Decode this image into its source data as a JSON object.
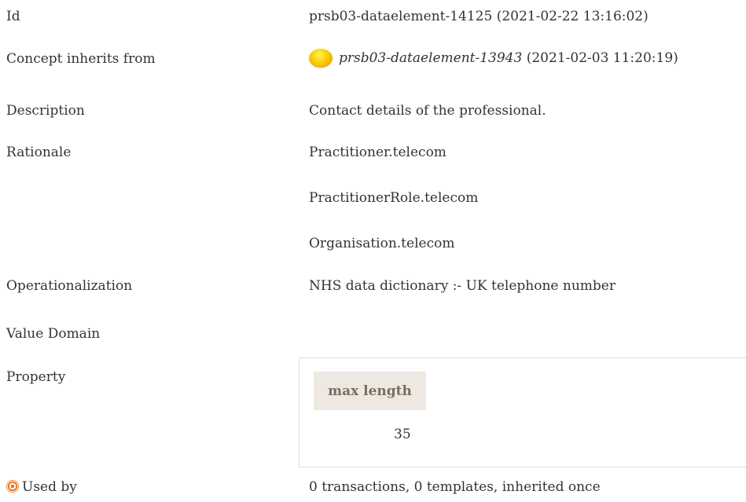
{
  "rows": {
    "id": {
      "label": "Id",
      "value": "prsb03-dataelement-14125 (2021-02-22 13:16:02)"
    },
    "inherits": {
      "label": "Concept inherits from",
      "ref": "prsb03-dataelement-13943",
      "date": "(2021-02-03 11:20:19)"
    },
    "description": {
      "label": "Description",
      "value": "Contact details of the professional."
    },
    "rationale": {
      "label": "Rationale",
      "lines": [
        "Practitioner.telecom",
        "PractitionerRole.telecom",
        "Organisation.telecom"
      ]
    },
    "operationalization": {
      "label": "Operationalization",
      "value": "NHS data dictionary :- UK telephone number"
    },
    "value_domain": {
      "label": "Value Domain"
    },
    "property": {
      "label": "Property",
      "header": "max length",
      "value": "35"
    },
    "used_by": {
      "label": "Used by",
      "value": "0 transactions, 0 templates, inherited once"
    }
  },
  "icons": {
    "inherit": "sun-icon",
    "used_by": "target-icon"
  },
  "colors": {
    "property_header_bg": "#ede9e2",
    "property_header_text": "#7a6e5e",
    "accent": "#e8741a"
  }
}
